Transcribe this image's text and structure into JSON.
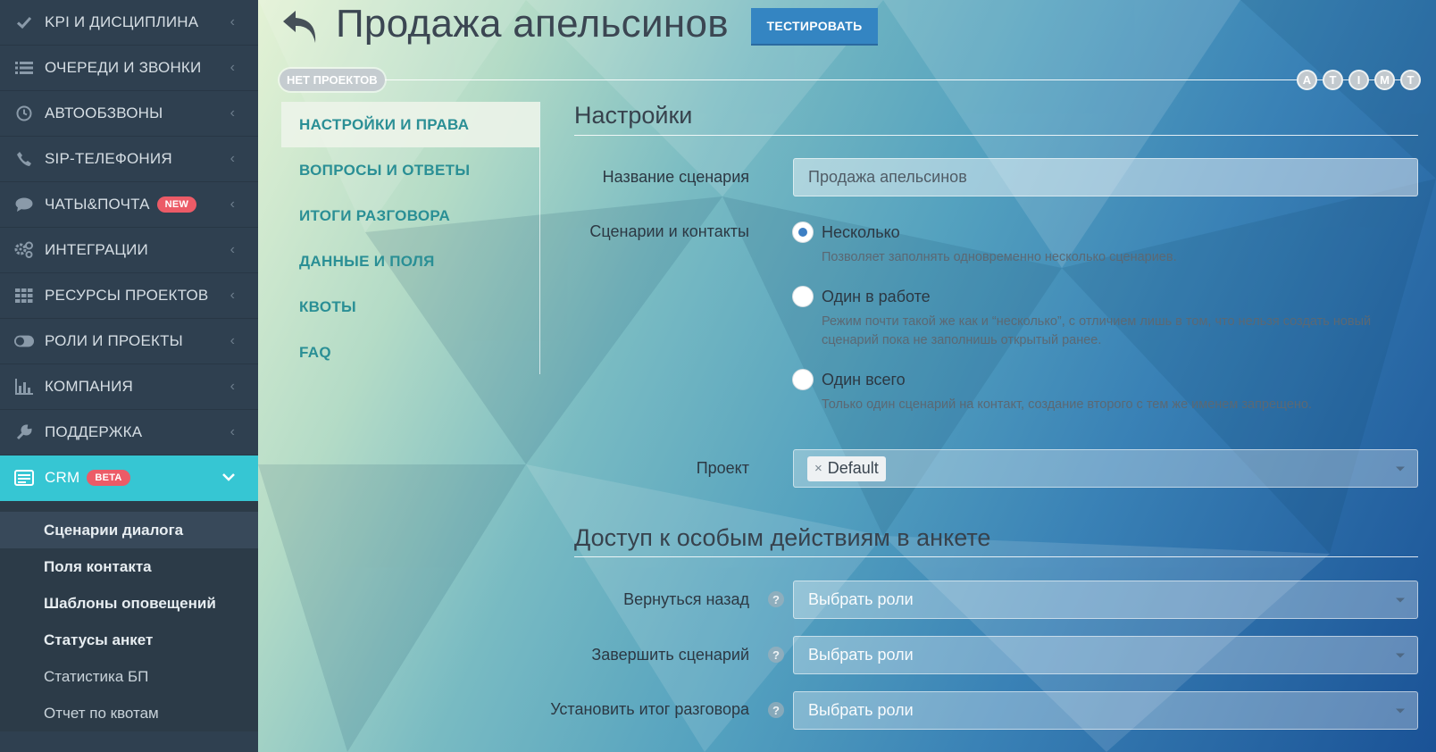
{
  "sidebar": {
    "items": [
      {
        "label": "KPI И ДИСЦИПЛИНА",
        "icon": "check-icon"
      },
      {
        "label": "ОЧЕРЕДИ И ЗВОНКИ",
        "icon": "list-icon"
      },
      {
        "label": "АВТООБЗВОНЫ",
        "icon": "clock-icon"
      },
      {
        "label": "SIP-ТЕЛЕФОНИЯ",
        "icon": "phone-icon"
      },
      {
        "label": "ЧАТЫ&ПОЧТА",
        "icon": "chat-icon",
        "badge": "NEW"
      },
      {
        "label": "ИНТЕГРАЦИИ",
        "icon": "gears-icon"
      },
      {
        "label": "РЕСУРСЫ ПРОЕКТОВ",
        "icon": "grid-icon"
      },
      {
        "label": "РОЛИ И ПРОЕКТЫ",
        "icon": "toggle-icon"
      },
      {
        "label": "КОМПАНИЯ",
        "icon": "bar-chart-icon"
      },
      {
        "label": "ПОДДЕРЖКА",
        "icon": "wrench-icon"
      }
    ],
    "crm": {
      "label": "CRM",
      "badge": "BETA",
      "icon": "crm-icon"
    },
    "sub_items": [
      "Сценарии диалога",
      "Поля контакта",
      "Шаблоны оповещений",
      "Статусы анкет",
      "Статистика БП",
      "Отчет по квотам"
    ]
  },
  "header": {
    "title": "Продажа апельсинов",
    "test_button": "ТЕСТИРОВАТЬ",
    "no_projects": "НЕТ ПРОЕКТОВ",
    "letters": [
      "A",
      "T",
      "I",
      "M",
      "T"
    ]
  },
  "tabs": [
    "НАСТРОЙКИ И ПРАВА",
    "ВОПРОСЫ И ОТВЕТЫ",
    "ИТОГИ РАЗГОВОРА",
    "ДАННЫЕ И ПОЛЯ",
    "КВОТЫ",
    "FAQ"
  ],
  "settings": {
    "title": "Настройки",
    "name_label": "Название сценария",
    "name_value": "Продажа апельсинов",
    "contacts_label": "Сценарии и контакты",
    "options": [
      {
        "label": "Несколько",
        "desc": "Позволяет заполнять одновременно несколько сценариев.",
        "selected": true
      },
      {
        "label": "Один в работе",
        "desc": "Режим почти такой же как и “несколько”, с отличием лишь в том, что нельзя создать новый сценарий пока не заполнишь открытый ранее.",
        "selected": false
      },
      {
        "label": "Один всего",
        "desc": "Только один сценарий на контакт, создание второго с тем же именем запрещено.",
        "selected": false
      }
    ],
    "project_label": "Проект",
    "project_tag": "Default",
    "tag_remove": "×"
  },
  "access": {
    "title": "Доступ к особым действиям в анкете",
    "placeholder": "Выбрать роли",
    "help": "?",
    "rows": [
      {
        "label": "Вернуться назад"
      },
      {
        "label": "Завершить сценарий"
      },
      {
        "label": "Установить итог разговора"
      }
    ]
  },
  "colors": {
    "sidebar_bg": "#2f4050",
    "active_nav": "#36c6d3",
    "badge": "#ec5b67",
    "accent_button": "#3485c2",
    "tab_text": "#2a8f95"
  }
}
